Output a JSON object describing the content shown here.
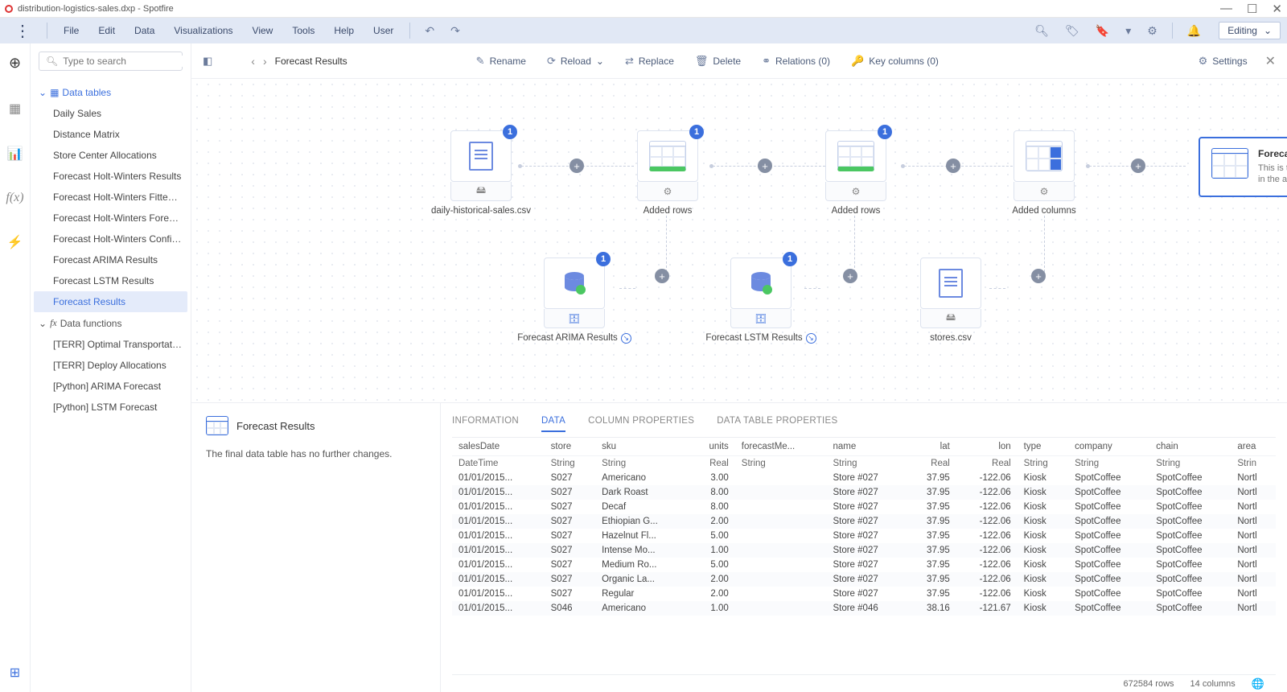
{
  "title": "distribution-logistics-sales.dxp - Spotfire",
  "menus": [
    "File",
    "Edit",
    "Data",
    "Visualizations",
    "View",
    "Tools",
    "Help",
    "User"
  ],
  "editing": "Editing",
  "search_placeholder": "Type to search",
  "tree": {
    "tables_label": "Data tables",
    "tables": [
      "Daily Sales",
      "Distance Matrix",
      "Store Center Allocations",
      "Forecast Holt-Winters Results",
      "Forecast Holt-Winters Fitted Line...",
      "Forecast Holt-Winters Forecast L...",
      "Forecast Holt-Winters Confidenc...",
      "Forecast ARIMA Results",
      "Forecast LSTM Results",
      "Forecast Results"
    ],
    "selected": 9,
    "funcs_label": "Data functions",
    "funcs": [
      "[TERR] Optimal Transportation B...",
      "[TERR] Deploy Allocations",
      "[Python] ARIMA Forecast",
      "[Python] LSTM Forecast"
    ]
  },
  "toolbar": {
    "crumb": "Forecast Results",
    "rename": "Rename",
    "reload": "Reload",
    "replace": "Replace",
    "delete": "Delete",
    "relations": "Relations (0)",
    "keycols": "Key columns (0)",
    "settings": "Settings"
  },
  "canvas": {
    "n1": "daily-historical-sales.csv",
    "n2": "Added rows",
    "n3": "Added rows",
    "n4": "Added columns",
    "b1": "Forecast ARIMA Results",
    "b2": "Forecast LSTM Results",
    "b3": "stores.csv",
    "result_title": "Forecast Results",
    "result_desc": "This is the data table used in the analysis."
  },
  "info": {
    "name": "Forecast Results",
    "desc": "The final data table has no further changes."
  },
  "tabs": [
    "INFORMATION",
    "DATA",
    "COLUMN PROPERTIES",
    "DATA TABLE PROPERTIES"
  ],
  "columns": [
    "salesDate",
    "store",
    "sku",
    "units",
    "forecastMe...",
    "name",
    "lat",
    "lon",
    "type",
    "company",
    "chain",
    "area"
  ],
  "types": [
    "DateTime",
    "String",
    "String",
    "Real",
    "String",
    "String",
    "Real",
    "Real",
    "String",
    "String",
    "String",
    "Strin"
  ],
  "rows": [
    [
      "01/01/2015...",
      "S027",
      "Americano",
      "3.00",
      "",
      "Store #027",
      "37.95",
      "-122.06",
      "Kiosk",
      "SpotCoffee",
      "SpotCoffee",
      "Nortl"
    ],
    [
      "01/01/2015...",
      "S027",
      "Dark Roast",
      "8.00",
      "",
      "Store #027",
      "37.95",
      "-122.06",
      "Kiosk",
      "SpotCoffee",
      "SpotCoffee",
      "Nortl"
    ],
    [
      "01/01/2015...",
      "S027",
      "Decaf",
      "8.00",
      "",
      "Store #027",
      "37.95",
      "-122.06",
      "Kiosk",
      "SpotCoffee",
      "SpotCoffee",
      "Nortl"
    ],
    [
      "01/01/2015...",
      "S027",
      "Ethiopian G...",
      "2.00",
      "",
      "Store #027",
      "37.95",
      "-122.06",
      "Kiosk",
      "SpotCoffee",
      "SpotCoffee",
      "Nortl"
    ],
    [
      "01/01/2015...",
      "S027",
      "Hazelnut Fl...",
      "5.00",
      "",
      "Store #027",
      "37.95",
      "-122.06",
      "Kiosk",
      "SpotCoffee",
      "SpotCoffee",
      "Nortl"
    ],
    [
      "01/01/2015...",
      "S027",
      "Intense Mo...",
      "1.00",
      "",
      "Store #027",
      "37.95",
      "-122.06",
      "Kiosk",
      "SpotCoffee",
      "SpotCoffee",
      "Nortl"
    ],
    [
      "01/01/2015...",
      "S027",
      "Medium Ro...",
      "5.00",
      "",
      "Store #027",
      "37.95",
      "-122.06",
      "Kiosk",
      "SpotCoffee",
      "SpotCoffee",
      "Nortl"
    ],
    [
      "01/01/2015...",
      "S027",
      "Organic La...",
      "2.00",
      "",
      "Store #027",
      "37.95",
      "-122.06",
      "Kiosk",
      "SpotCoffee",
      "SpotCoffee",
      "Nortl"
    ],
    [
      "01/01/2015...",
      "S027",
      "Regular",
      "2.00",
      "",
      "Store #027",
      "37.95",
      "-122.06",
      "Kiosk",
      "SpotCoffee",
      "SpotCoffee",
      "Nortl"
    ],
    [
      "01/01/2015...",
      "S046",
      "Americano",
      "1.00",
      "",
      "Store #046",
      "38.16",
      "-121.67",
      "Kiosk",
      "SpotCoffee",
      "SpotCoffee",
      "Nortl"
    ]
  ],
  "status": {
    "rows": "672584 rows",
    "cols": "14 columns"
  }
}
